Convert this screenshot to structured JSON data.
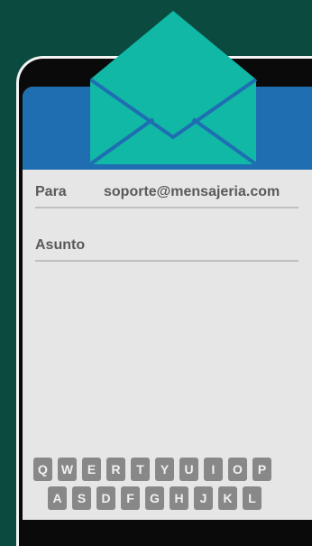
{
  "email": {
    "to_label": "Para",
    "to_value": "soporte@mensajeria.com",
    "subject_label": "Asunto",
    "subject_value": ""
  },
  "keyboard": {
    "row1": [
      "Q",
      "W",
      "E",
      "R",
      "T",
      "Y",
      "U",
      "I",
      "O",
      "P"
    ],
    "row2": [
      "A",
      "S",
      "D",
      "F",
      "G",
      "H",
      "J",
      "K",
      "L"
    ]
  },
  "colors": {
    "background": "#0b4a3f",
    "header": "#1e6eb1",
    "envelope": "#11b8a6",
    "screen": "#e6e6e6",
    "key": "#888888"
  },
  "icons": {
    "envelope": "open-envelope-icon"
  }
}
